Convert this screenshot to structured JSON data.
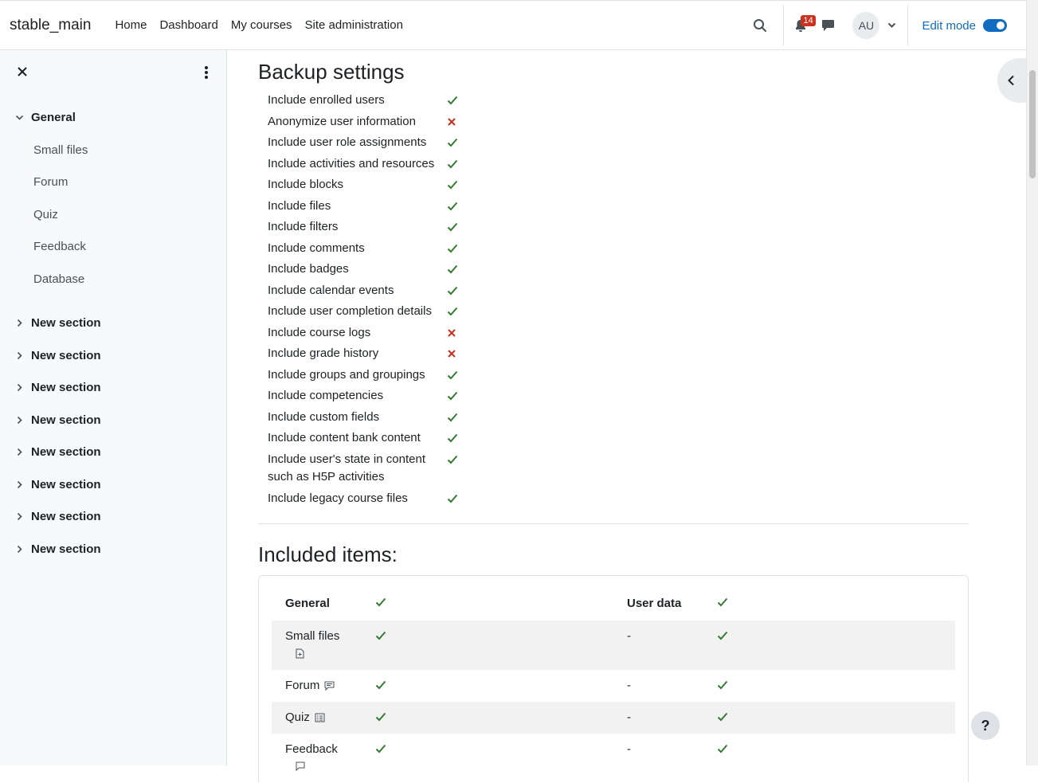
{
  "navbar": {
    "brand": "stable_main",
    "links": [
      "Home",
      "Dashboard",
      "My courses",
      "Site administration"
    ],
    "notification_count": "14",
    "avatar_initials": "AU",
    "edit_mode_label": "Edit mode"
  },
  "sidebar": {
    "general_label": "General",
    "items": [
      "Small files",
      "Forum",
      "Quiz",
      "Feedback",
      "Database"
    ],
    "sections": [
      "New section",
      "New section",
      "New section",
      "New section",
      "New section",
      "New section",
      "New section",
      "New section"
    ]
  },
  "backup": {
    "title": "Backup settings",
    "settings": [
      {
        "label": "Include enrolled users",
        "enabled": true
      },
      {
        "label": "Anonymize user information",
        "enabled": false
      },
      {
        "label": "Include user role assignments",
        "enabled": true
      },
      {
        "label": "Include activities and resources",
        "enabled": true
      },
      {
        "label": "Include blocks",
        "enabled": true
      },
      {
        "label": "Include files",
        "enabled": true
      },
      {
        "label": "Include filters",
        "enabled": true
      },
      {
        "label": "Include comments",
        "enabled": true
      },
      {
        "label": "Include badges",
        "enabled": true
      },
      {
        "label": "Include calendar events",
        "enabled": true
      },
      {
        "label": "Include user completion details",
        "enabled": true
      },
      {
        "label": "Include course logs",
        "enabled": false
      },
      {
        "label": "Include grade history",
        "enabled": false
      },
      {
        "label": "Include groups and groupings",
        "enabled": true
      },
      {
        "label": "Include competencies",
        "enabled": true
      },
      {
        "label": "Include custom fields",
        "enabled": true
      },
      {
        "label": "Include content bank content",
        "enabled": true
      },
      {
        "label": "Include user's state in content such as H5P activities",
        "enabled": true
      },
      {
        "label": "Include legacy course files",
        "enabled": true
      }
    ]
  },
  "included": {
    "title": "Included items:",
    "header": {
      "name": "General",
      "user_data_label": "User data"
    },
    "rows": [
      {
        "name": "Small files",
        "icon": "file-icon",
        "dash": "-"
      },
      {
        "name": "Forum",
        "icon": "forum-icon",
        "dash": "-"
      },
      {
        "name": "Quiz",
        "icon": "quiz-icon",
        "dash": "-"
      },
      {
        "name": "Feedback",
        "icon": "feedback-icon",
        "dash": "-"
      }
    ]
  },
  "help": {
    "label": "?"
  },
  "colors": {
    "check": "#357a32",
    "cross": "#ca3120",
    "accent": "#0f6cbf"
  }
}
